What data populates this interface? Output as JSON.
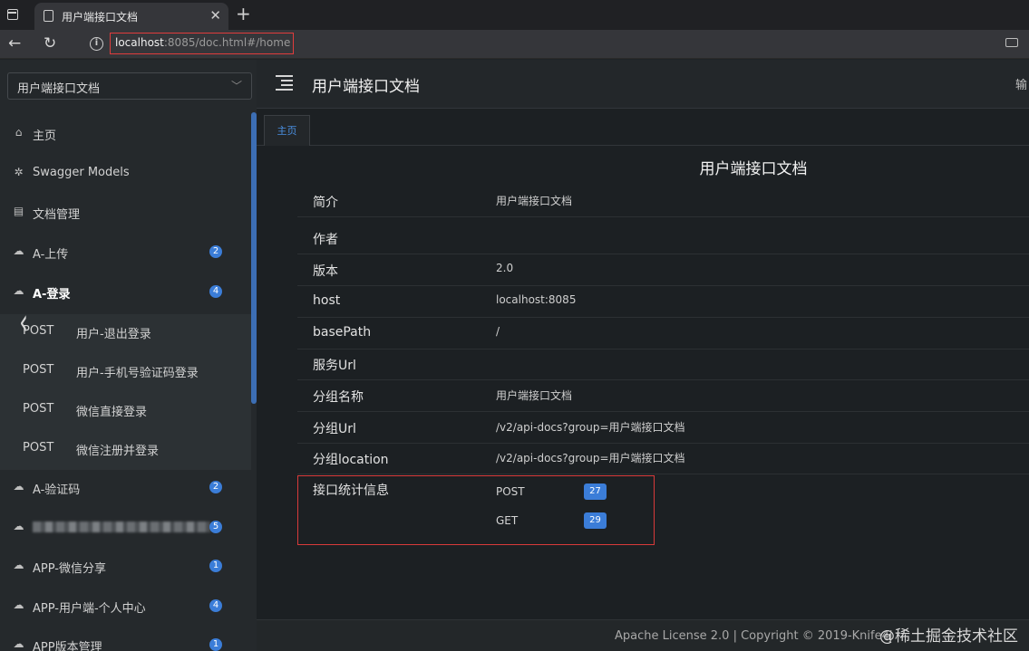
{
  "browser": {
    "tab_title": "用户端接口文档",
    "tab_close": "✕",
    "new_tab": "+",
    "url_host": "localhost",
    "url_rest": ":8085/doc.html#/home"
  },
  "sidebar": {
    "group_select": {
      "value": "用户端接口文档"
    },
    "items": [
      {
        "label": "主页",
        "icon": "home-icon"
      },
      {
        "label": "Swagger Models",
        "icon": "models-icon"
      },
      {
        "label": "文档管理",
        "icon": "doc-manage-icon"
      },
      {
        "label": "A-上传",
        "icon": "cloud-icon",
        "badge": "2"
      },
      {
        "label": "A-登录",
        "icon": "cloud-icon",
        "badge": "4"
      },
      {
        "label": "A-验证码",
        "icon": "cloud-icon",
        "badge": "2"
      },
      {
        "label": "",
        "icon": "cloud-icon",
        "badge": "5"
      },
      {
        "label": "APP-微信分享",
        "icon": "cloud-icon",
        "badge": "1"
      },
      {
        "label": "APP-用户端-个人中心",
        "icon": "cloud-icon",
        "badge": "4"
      },
      {
        "label": "APP版本管理",
        "icon": "cloud-icon",
        "badge": "1"
      }
    ],
    "sub_items": [
      {
        "method": "POST",
        "label": "用户-退出登录"
      },
      {
        "method": "POST",
        "label": "用户-手机号验证码登录"
      },
      {
        "method": "POST",
        "label": "微信直接登录"
      },
      {
        "method": "POST",
        "label": "微信注册并登录"
      }
    ]
  },
  "header": {
    "title": "用户端接口文档",
    "right_text": "输"
  },
  "tabs": [
    {
      "label": "主页"
    }
  ],
  "doc": {
    "title": "用户端接口文档",
    "rows": [
      {
        "label": "简介",
        "value": "用户端接口文档"
      },
      {
        "label": "作者",
        "value": ""
      },
      {
        "label": "版本",
        "value": "2.0"
      },
      {
        "label": "host",
        "value": "localhost:8085"
      },
      {
        "label": "basePath",
        "value": "/"
      },
      {
        "label": "服务Url",
        "value": ""
      },
      {
        "label": "分组名称",
        "value": "用户端接口文档"
      },
      {
        "label": "分组Url",
        "value": "/v2/api-docs?group=用户端接口文档"
      },
      {
        "label": "分组location",
        "value": "/v2/api-docs?group=用户端接口文档"
      }
    ],
    "stats": {
      "label": "接口统计信息",
      "items": [
        {
          "method": "POST",
          "count": "27"
        },
        {
          "method": "GET",
          "count": "29"
        }
      ]
    }
  },
  "footer": {
    "text": "Apache License 2.0 | Copyright © 2019-Knife4j"
  },
  "watermark": "@稀土掘金技术社区",
  "colors": {
    "accent": "#3b7dd8",
    "highlight_box": "#d83a3a",
    "sidebar_bg": "#25292c",
    "main_bg": "#1c2023"
  }
}
